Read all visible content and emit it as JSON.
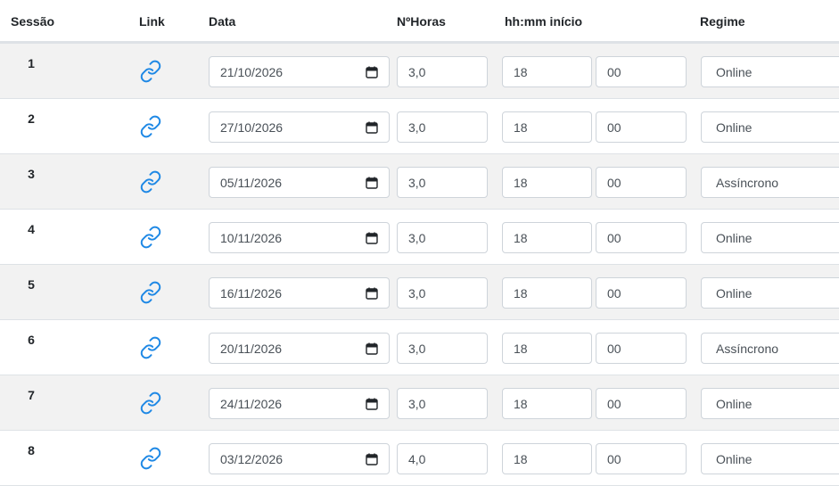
{
  "headers": {
    "sessao": "Sessão",
    "link": "Link",
    "data": "Data",
    "horas": "NºHoras",
    "inicio": "hh:mm início",
    "regime": "Regime"
  },
  "icons": {
    "link": "link-chain-icon",
    "calendar": "calendar-icon"
  },
  "colors": {
    "link_icon": "#1e88e5",
    "stripe": "#f2f2f2",
    "border": "#ced4da"
  },
  "rows": [
    {
      "sessao": "1",
      "data": "21/10/2026",
      "horas": "3,0",
      "hh": "18",
      "mm": "00",
      "regime": "Online"
    },
    {
      "sessao": "2",
      "data": "27/10/2026",
      "horas": "3,0",
      "hh": "18",
      "mm": "00",
      "regime": "Online"
    },
    {
      "sessao": "3",
      "data": "05/11/2026",
      "horas": "3,0",
      "hh": "18",
      "mm": "00",
      "regime": "Assíncrono"
    },
    {
      "sessao": "4",
      "data": "10/11/2026",
      "horas": "3,0",
      "hh": "18",
      "mm": "00",
      "regime": "Online"
    },
    {
      "sessao": "5",
      "data": "16/11/2026",
      "horas": "3,0",
      "hh": "18",
      "mm": "00",
      "regime": "Online"
    },
    {
      "sessao": "6",
      "data": "20/11/2026",
      "horas": "3,0",
      "hh": "18",
      "mm": "00",
      "regime": "Assíncrono"
    },
    {
      "sessao": "7",
      "data": "24/11/2026",
      "horas": "3,0",
      "hh": "18",
      "mm": "00",
      "regime": "Online"
    },
    {
      "sessao": "8",
      "data": "03/12/2026",
      "horas": "4,0",
      "hh": "18",
      "mm": "00",
      "regime": "Online"
    }
  ]
}
